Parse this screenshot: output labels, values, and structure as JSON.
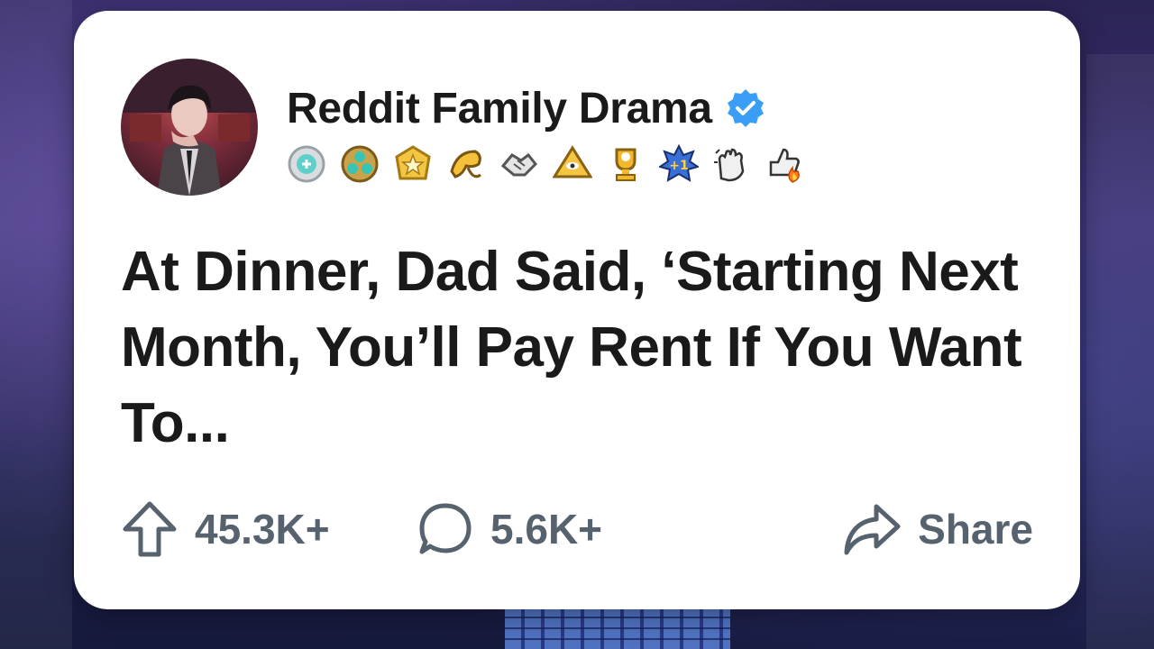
{
  "post": {
    "author": "Reddit Family Drama",
    "verified": true,
    "title": "At Dinner, Dad Said, ‘Starting Next Month, You’ll Pay Rent If You Want To...",
    "upvotes": "45.3K+",
    "comments": "5.6K+",
    "share_label": "Share"
  },
  "awards": [
    "silver-award-icon",
    "platinum-award-icon",
    "gold-award-icon",
    "tongue-award-icon",
    "handshake-award-icon",
    "pyramid-award-icon",
    "trophy-award-icon",
    "plus-one-award-icon",
    "clapping-award-icon",
    "thumbs-up-fire-award-icon"
  ],
  "colors": {
    "card": "#ffffff",
    "text": "#1a1a1b",
    "muted": "#56626d",
    "verified": "#3b9ef5"
  }
}
